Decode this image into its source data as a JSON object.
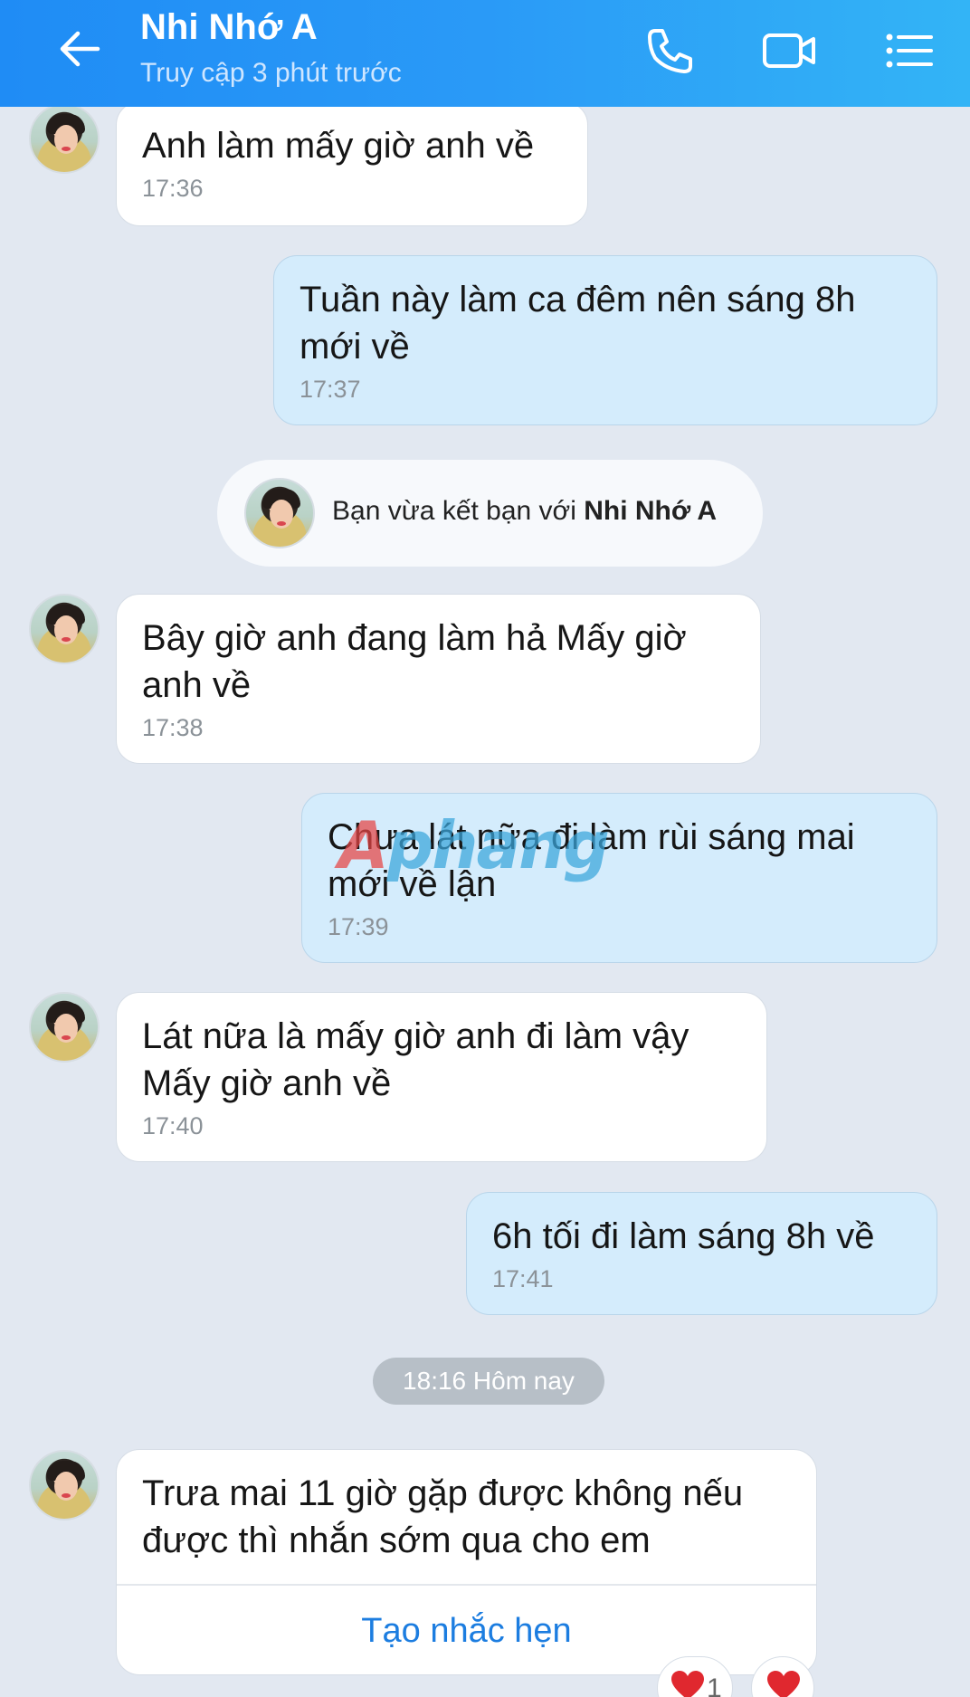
{
  "header": {
    "title": "Nhi Nhớ A",
    "subtitle": "Truy cập 3 phút trước",
    "icons": [
      "back-arrow-icon",
      "phone-icon",
      "video-camera-icon",
      "list-menu-icon"
    ]
  },
  "messages": [
    {
      "from": "contact",
      "text": "Anh làm mấy giờ anh về",
      "time": "17:36"
    },
    {
      "from": "me",
      "text": "Tuần này làm ca đêm nên sáng 8h mới về",
      "time": "17:37"
    },
    {
      "from": "contact",
      "text": "Bây giờ anh đang làm hả Mấy giờ anh về",
      "time": "17:38"
    },
    {
      "from": "me",
      "text": "Chưa lát nữa đi làm rùi sáng mai mới về lận",
      "time": "17:39"
    },
    {
      "from": "contact",
      "text": "Lát nữa là mấy giờ anh đi làm vậy Mấy giờ anh về",
      "time": "17:40"
    },
    {
      "from": "me",
      "text": "6h tối đi làm sáng 8h về",
      "time": "17:41"
    }
  ],
  "notice": {
    "prefix": "Bạn vừa kết bạn với ",
    "name": "Nhi Nhớ A"
  },
  "date_divider": "18:16 Hôm nay",
  "last_message": {
    "text": "Trưa mai 11 giờ gặp được không nếu được thì nhắn sớm qua cho em",
    "action": "Tạo nhắc hẹn"
  },
  "reactions": [
    {
      "icon": "heart-icon",
      "count": "1"
    },
    {
      "icon": "heart-icon",
      "count": ""
    }
  ],
  "watermark": {
    "part_a": "A",
    "part_b": "phang"
  },
  "colors": {
    "header_gradient_start": "#1f8cf5",
    "header_gradient_end": "#33b4f6",
    "outgoing_bubble": "#d4ecfc",
    "incoming_bubble": "#ffffff",
    "chat_background": "#e2e8f1",
    "action_link": "#1c7de0"
  }
}
